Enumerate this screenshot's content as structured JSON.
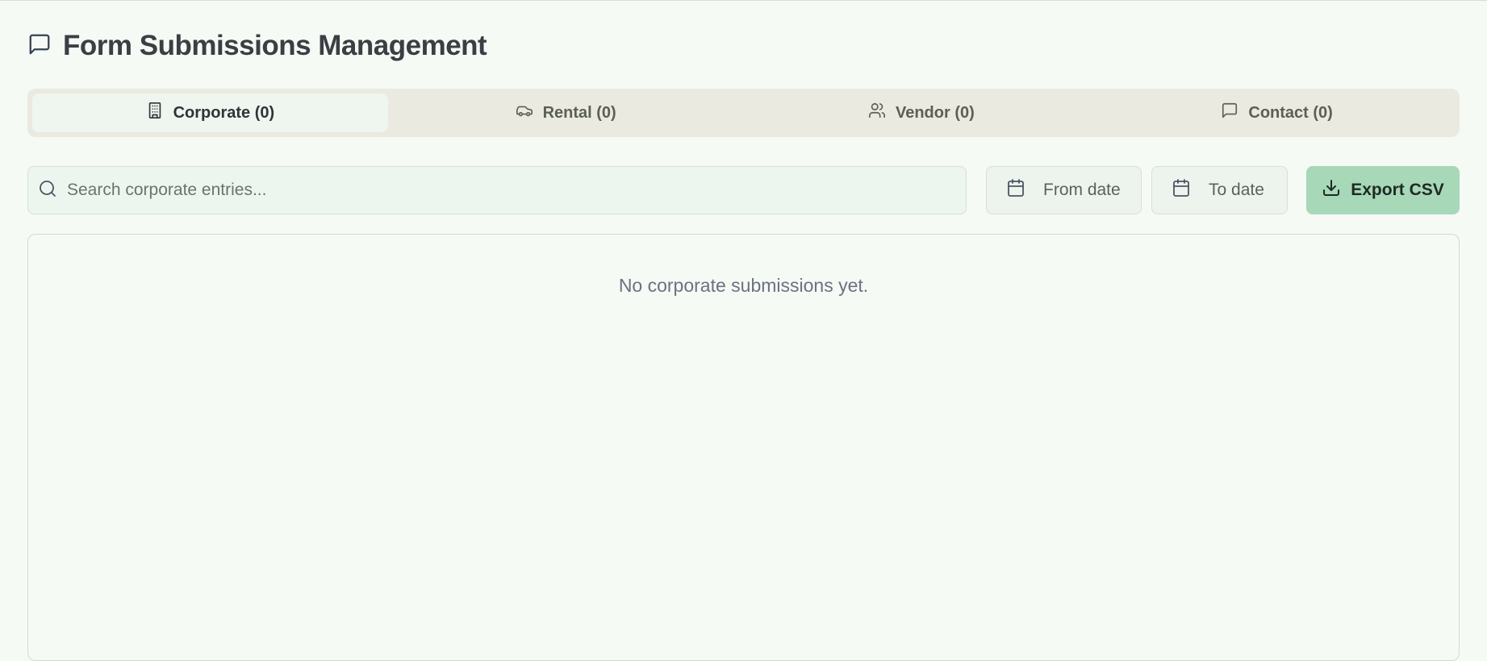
{
  "header": {
    "title": "Form Submissions Management",
    "icon": "message-square-icon"
  },
  "tabs": [
    {
      "label": "Corporate (0)",
      "icon": "building-icon",
      "active": true
    },
    {
      "label": "Rental (0)",
      "icon": "car-icon",
      "active": false
    },
    {
      "label": "Vendor (0)",
      "icon": "users-icon",
      "active": false
    },
    {
      "label": "Contact (0)",
      "icon": "message-square-icon",
      "active": false
    }
  ],
  "toolbar": {
    "search_placeholder": "Search corporate entries...",
    "search_value": "",
    "from_date_label": "From date",
    "to_date_label": "To date",
    "export_label": "Export CSV"
  },
  "panel": {
    "empty_message": "No corporate submissions yet."
  },
  "colors": {
    "background": "#f5faf5",
    "tab_bar": "#ebeae0",
    "active_tab": "#eef6ef",
    "export_button": "#a7d8b8"
  }
}
